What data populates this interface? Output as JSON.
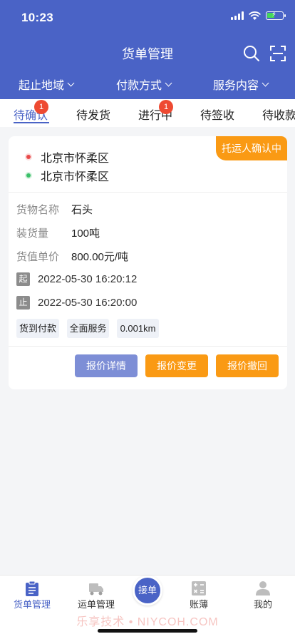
{
  "status_bar": {
    "time": "10:23"
  },
  "header": {
    "title": "货单管理",
    "icons": [
      "search-icon",
      "scan-icon"
    ],
    "filters": [
      {
        "label": "起止地域"
      },
      {
        "label": "付款方式"
      },
      {
        "label": "服务内容"
      }
    ]
  },
  "tabs": [
    {
      "label": "待确认",
      "badge": "1",
      "active": true
    },
    {
      "label": "待发货"
    },
    {
      "label": "进行中",
      "badge": "1"
    },
    {
      "label": "待签收"
    },
    {
      "label": "待收款"
    }
  ],
  "card": {
    "status": "托运人确认中",
    "origin": "北京市怀柔区",
    "destination": "北京市怀柔区",
    "fields": [
      {
        "key": "货物名称",
        "value": "石头"
      },
      {
        "key": "装货量",
        "value": "100吨"
      },
      {
        "key": "货值单价",
        "value": "800.00元/吨"
      }
    ],
    "start": {
      "mark": "起",
      "time": "2022-05-30 16:20:12"
    },
    "end": {
      "mark": "止",
      "time": "2022-05-30 16:20:00"
    },
    "chips": [
      "货到付款",
      "全面服务",
      "0.001km"
    ],
    "buttons": [
      "报价详情",
      "报价变更",
      "报价撤回"
    ]
  },
  "tabbar": {
    "items": [
      {
        "label": "货单管理",
        "icon": "clipboard-icon",
        "active": true
      },
      {
        "label": "运单管理",
        "icon": "truck-icon"
      },
      {
        "label": "账薄",
        "icon": "calculator-icon"
      },
      {
        "label": "我的",
        "icon": "user-icon"
      }
    ],
    "center": "接单"
  },
  "watermark": "乐享技术 • NIYCOH.COM",
  "colors": {
    "primary": "#4a63c6",
    "accent": "#fa9a14",
    "badge": "#ee4a32"
  }
}
